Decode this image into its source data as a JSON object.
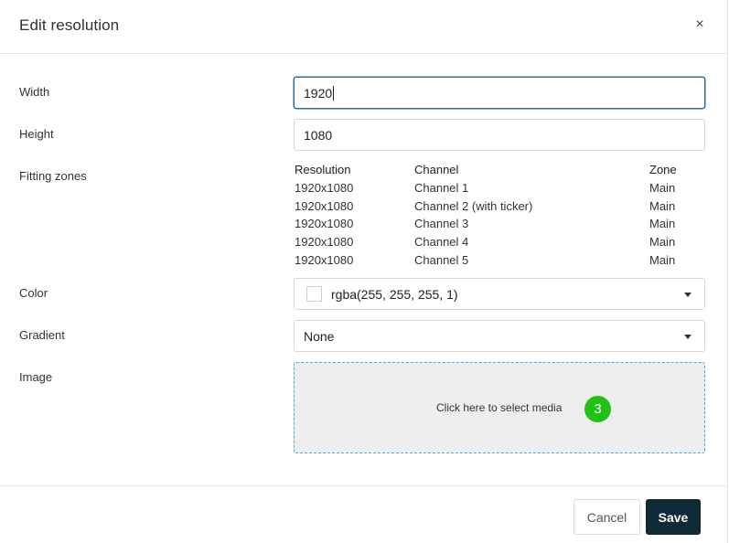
{
  "dialog": {
    "title": "Edit resolution",
    "close_symbol": "×"
  },
  "form": {
    "width": {
      "label": "Width",
      "value": "1920"
    },
    "height": {
      "label": "Height",
      "value": "1080"
    },
    "fitting_zones": {
      "label": "Fitting zones",
      "columns": [
        "Resolution",
        "Channel",
        "Zone"
      ],
      "rows": [
        [
          "1920x1080",
          "Channel 1",
          "Main"
        ],
        [
          "1920x1080",
          "Channel 2 (with ticker)",
          "Main"
        ],
        [
          "1920x1080",
          "Channel 3",
          "Main"
        ],
        [
          "1920x1080",
          "Channel 4",
          "Main"
        ],
        [
          "1920x1080",
          "Channel 5",
          "Main"
        ]
      ]
    },
    "color": {
      "label": "Color",
      "value": "rgba(255, 255, 255, 1)",
      "swatch": "#ffffff"
    },
    "gradient": {
      "label": "Gradient",
      "value": "None"
    },
    "image": {
      "label": "Image",
      "placeholder": "Click here to select media",
      "badge": "3"
    }
  },
  "footer": {
    "cancel_label": "Cancel",
    "save_label": "Save"
  },
  "colors": {
    "accent": "#2b6ca3",
    "save_button": "#0f2a37",
    "badge": "#22c116",
    "dropzone_border": "#5aa3d8"
  }
}
